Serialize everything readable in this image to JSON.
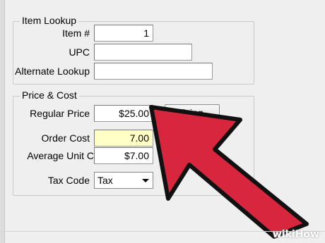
{
  "item_lookup": {
    "title": "Item Lookup",
    "item_number": {
      "label": "Item #",
      "value": "1"
    },
    "upc": {
      "label": "UPC",
      "value": ""
    },
    "alternate_lookup": {
      "label": "Alternate Lookup",
      "value": ""
    }
  },
  "price_cost": {
    "title": "Price & Cost",
    "regular_price": {
      "label": "Regular Price",
      "value": "$25.00"
    },
    "pricing_button": "Pricing...",
    "order_cost": {
      "label": "Order Cost",
      "value": "7.00"
    },
    "average_unit_cost": {
      "label": "Average Unit C",
      "value": "$7.00"
    },
    "tax_code": {
      "label": "Tax Code",
      "value": "Tax"
    }
  },
  "colors": {
    "arrow_fill": "#d7263d",
    "arrow_outline": "#111111",
    "highlight_field": "#ffffc6"
  },
  "watermark": {
    "prefix": "wiki",
    "suffix": "How"
  }
}
